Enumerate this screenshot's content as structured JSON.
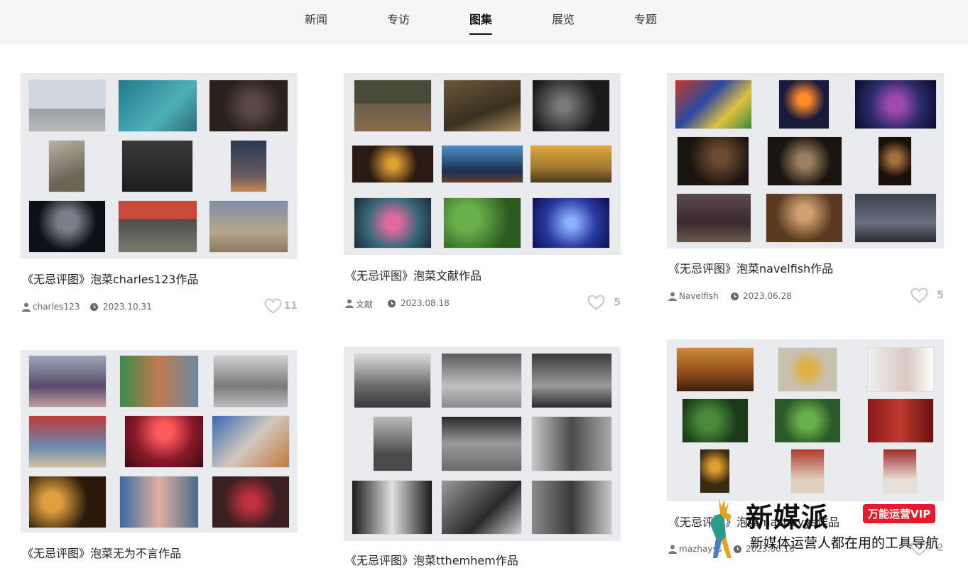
{
  "nav": {
    "tabs": [
      {
        "label": "新闻"
      },
      {
        "label": "专访"
      },
      {
        "label": "图集",
        "active": true
      },
      {
        "label": "展览"
      },
      {
        "label": "专题"
      }
    ]
  },
  "cards": [
    {
      "title": "《无忌评图》泡菜charles123作品",
      "author": "charles123",
      "date": "2023.10.31",
      "likes": "11"
    },
    {
      "title": "《无忌评图》泡菜文献作品",
      "author": "文献",
      "date": "2023.08.18",
      "likes": "5"
    },
    {
      "title": "《无忌评图》泡菜navelfish作品",
      "author": "Navelfish",
      "date": "2023.06.28",
      "likes": "5"
    },
    {
      "title": "《无忌评图》泡菜无为不言作品",
      "author": "",
      "date": "",
      "likes": ""
    },
    {
      "title": "《无忌评图》泡菜tthemhem作品",
      "author": "",
      "date": "",
      "likes": ""
    },
    {
      "title": "《无忌评图》泡菜mazhayys作品",
      "author": "mazhayys",
      "date": "2023.06.16",
      "likes": "2"
    }
  ],
  "watermark": {
    "name": "新媒派",
    "badge": "万能运营VIP",
    "slogan": "新媒体运营人都在用的工具导航"
  },
  "colors": {
    "nav_bg": "#f5f6f7",
    "cover_bg": "#e9ebee",
    "like_gray": "#bbbbbb",
    "badge_red": "#e8192c"
  }
}
